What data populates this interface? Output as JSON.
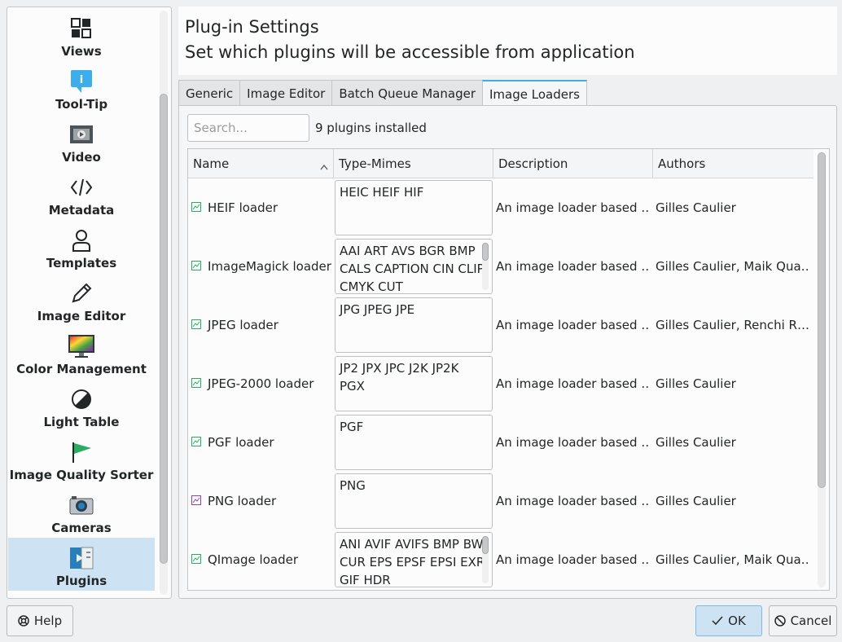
{
  "header": {
    "title": "Plug-in Settings",
    "subtitle": "Set which plugins will be accessible from application"
  },
  "sidebar": {
    "items": [
      {
        "label": "Views",
        "icon": "views-grid-icon"
      },
      {
        "label": "Tool-Tip",
        "icon": "tooltip-icon"
      },
      {
        "label": "Video",
        "icon": "video-icon"
      },
      {
        "label": "Metadata",
        "icon": "metadata-code-icon"
      },
      {
        "label": "Templates",
        "icon": "person-icon"
      },
      {
        "label": "Image Editor",
        "icon": "pencil-icon"
      },
      {
        "label": "Color Management",
        "icon": "color-monitor-icon"
      },
      {
        "label": "Light Table",
        "icon": "light-table-icon"
      },
      {
        "label": "Image Quality Sorter",
        "icon": "flag-icon"
      },
      {
        "label": "Cameras",
        "icon": "camera-icon"
      },
      {
        "label": "Plugins",
        "icon": "plugins-icon",
        "selected": true
      }
    ]
  },
  "tabs": [
    {
      "label": "Generic"
    },
    {
      "label": "Image Editor"
    },
    {
      "label": "Batch Queue Manager"
    },
    {
      "label": "Image Loaders",
      "active": true
    }
  ],
  "search": {
    "placeholder": "Search...",
    "value": ""
  },
  "plugin_count": "9 plugins installed",
  "table": {
    "columns": [
      "Name",
      "Type-Mimes",
      "Description",
      "Authors"
    ],
    "sorted_column": "Name",
    "rows": [
      {
        "name": "HEIF loader",
        "mimes": "HEIC HEIF HIF",
        "description": "An image loader based …",
        "authors": "Gilles Caulier",
        "icon_color": "#27ae60",
        "mime_scroll": false
      },
      {
        "name": "ImageMagick loader",
        "mimes": "AAI ART AVS BGR BMP CALS CAPTION CIN CLIP CMYK CUT",
        "description": "An image loader based …",
        "authors": "Gilles Caulier, Maik Qua…",
        "icon_color": "#27ae60",
        "mime_scroll": true
      },
      {
        "name": "JPEG loader",
        "mimes": "JPG JPEG JPE",
        "description": "An image loader based …",
        "authors": "Gilles Caulier, Renchi R…",
        "icon_color": "#27ae60",
        "mime_scroll": false
      },
      {
        "name": "JPEG-2000 loader",
        "mimes": "JP2 JPX JPC J2K JP2K PGX",
        "description": "An image loader based …",
        "authors": "Gilles Caulier",
        "icon_color": "#27ae60",
        "mime_scroll": false
      },
      {
        "name": "PGF loader",
        "mimes": "PGF",
        "description": "An image loader based …",
        "authors": "Gilles Caulier",
        "icon_color": "#27ae60",
        "mime_scroll": false
      },
      {
        "name": "PNG loader",
        "mimes": "PNG",
        "description": "An image loader based …",
        "authors": "Gilles Caulier",
        "icon_color": "#8e44ad",
        "mime_scroll": false
      },
      {
        "name": "QImage loader",
        "mimes": "ANI AVIF AVIFS BMP BW CUR EPS EPSF EPSI EXR GIF HDR",
        "description": "An image loader based …",
        "authors": "Gilles Caulier, Maik Qua…",
        "icon_color": "#27ae60",
        "mime_scroll": true
      }
    ]
  },
  "footer": {
    "help_label": "Help",
    "ok_label": "OK",
    "cancel_label": "Cancel"
  }
}
